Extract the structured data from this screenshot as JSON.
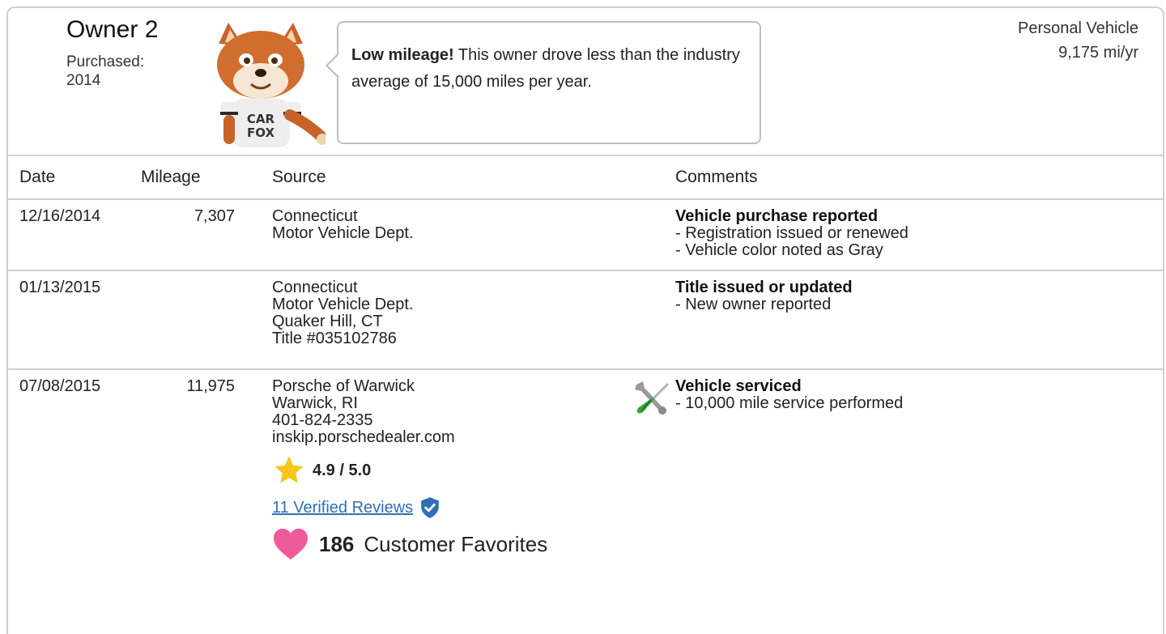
{
  "owner": {
    "title": "Owner 2",
    "purchased_label": "Purchased:",
    "purchased_year": "2014",
    "usage_type": "Personal Vehicle",
    "usage_rate": "9,175 mi/yr",
    "mascot_shirt": [
      "CAR",
      "FOX"
    ]
  },
  "bubble": {
    "bold": "Low mileage!",
    "text": " This owner drove less than the industry average of 15,000 miles per year."
  },
  "table": {
    "headers": {
      "date": "Date",
      "mileage": "Mileage",
      "source": "Source",
      "comments": "Comments"
    },
    "rows": [
      {
        "date": "12/16/2014",
        "mileage": "7,307",
        "source": [
          "Connecticut",
          "Motor Vehicle Dept."
        ],
        "comment_title": "Vehicle purchase reported",
        "comment_lines": [
          "- Registration issued or renewed",
          "- Vehicle color noted as Gray"
        ]
      },
      {
        "date": "01/13/2015",
        "mileage": "",
        "source": [
          "Connecticut",
          "Motor Vehicle Dept.",
          "Quaker Hill, CT",
          "Title #035102786"
        ],
        "comment_title": "Title issued or updated",
        "comment_lines": [
          "- New owner reported"
        ]
      },
      {
        "date": "07/08/2015",
        "mileage": "11,975",
        "source": [
          "Porsche of Warwick",
          "Warwick, RI",
          "401-824-2335",
          "inskip.porschedealer.com"
        ],
        "rating": "4.9 / 5.0",
        "reviews_link": "11 Verified Reviews",
        "favorites_count": "186",
        "favorites_label": "Customer Favorites",
        "comment_title": "Vehicle serviced",
        "comment_lines": [
          "- 10,000 mile service performed"
        ]
      }
    ]
  },
  "colors": {
    "link": "#2f6fb6",
    "star": "#f5c518",
    "heart": "#ef5a9a",
    "verified": "#2f6fb6",
    "border": "#cfcfcf"
  }
}
